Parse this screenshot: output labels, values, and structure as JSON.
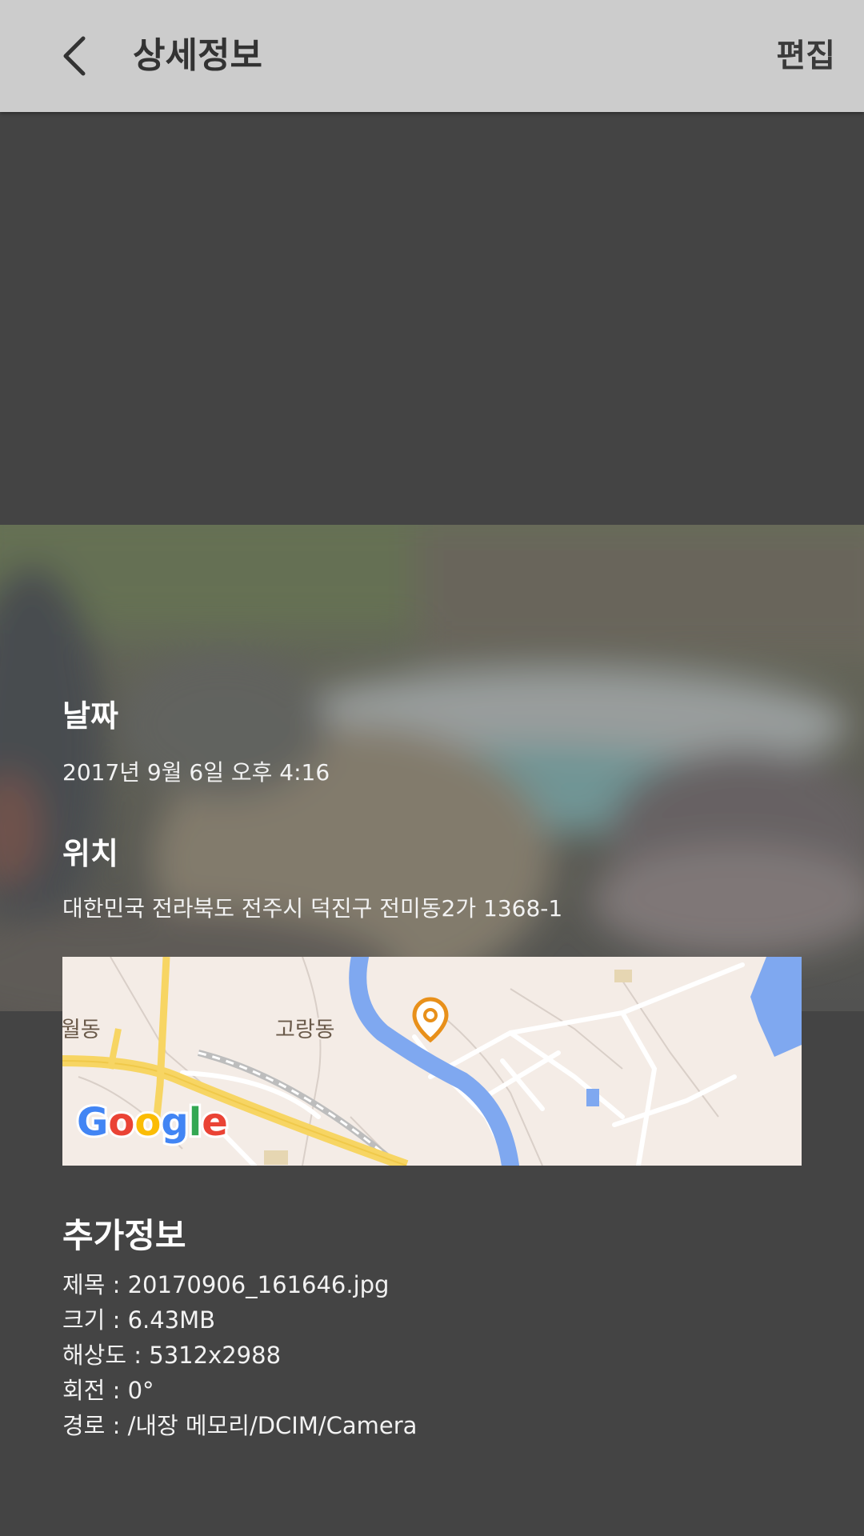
{
  "header": {
    "title": "상세정보",
    "edit_label": "편집"
  },
  "date": {
    "heading": "날짜",
    "value": "2017년 9월 6일 오후 4:16"
  },
  "location": {
    "heading": "위치",
    "value": "대한민국 전라북도 전주시 덕진구 전미동2가 1368-1",
    "map": {
      "labels": [
        "월동",
        "고랑동"
      ],
      "logo": "Google",
      "pin_color": "#e8901a"
    }
  },
  "extra": {
    "heading": "추가정보",
    "title_row": "제목 : 20170906_161646.jpg",
    "size_row": "크기 : 6.43MB",
    "resolution_row": "해상도 : 5312x2988",
    "rotation_row": "회전 : 0°",
    "path_row": "경로 : /내장 메모리/DCIM/Camera"
  },
  "colors": {
    "appbar": "#cccccc",
    "background": "#444444",
    "accent_pin": "#e8901a"
  }
}
